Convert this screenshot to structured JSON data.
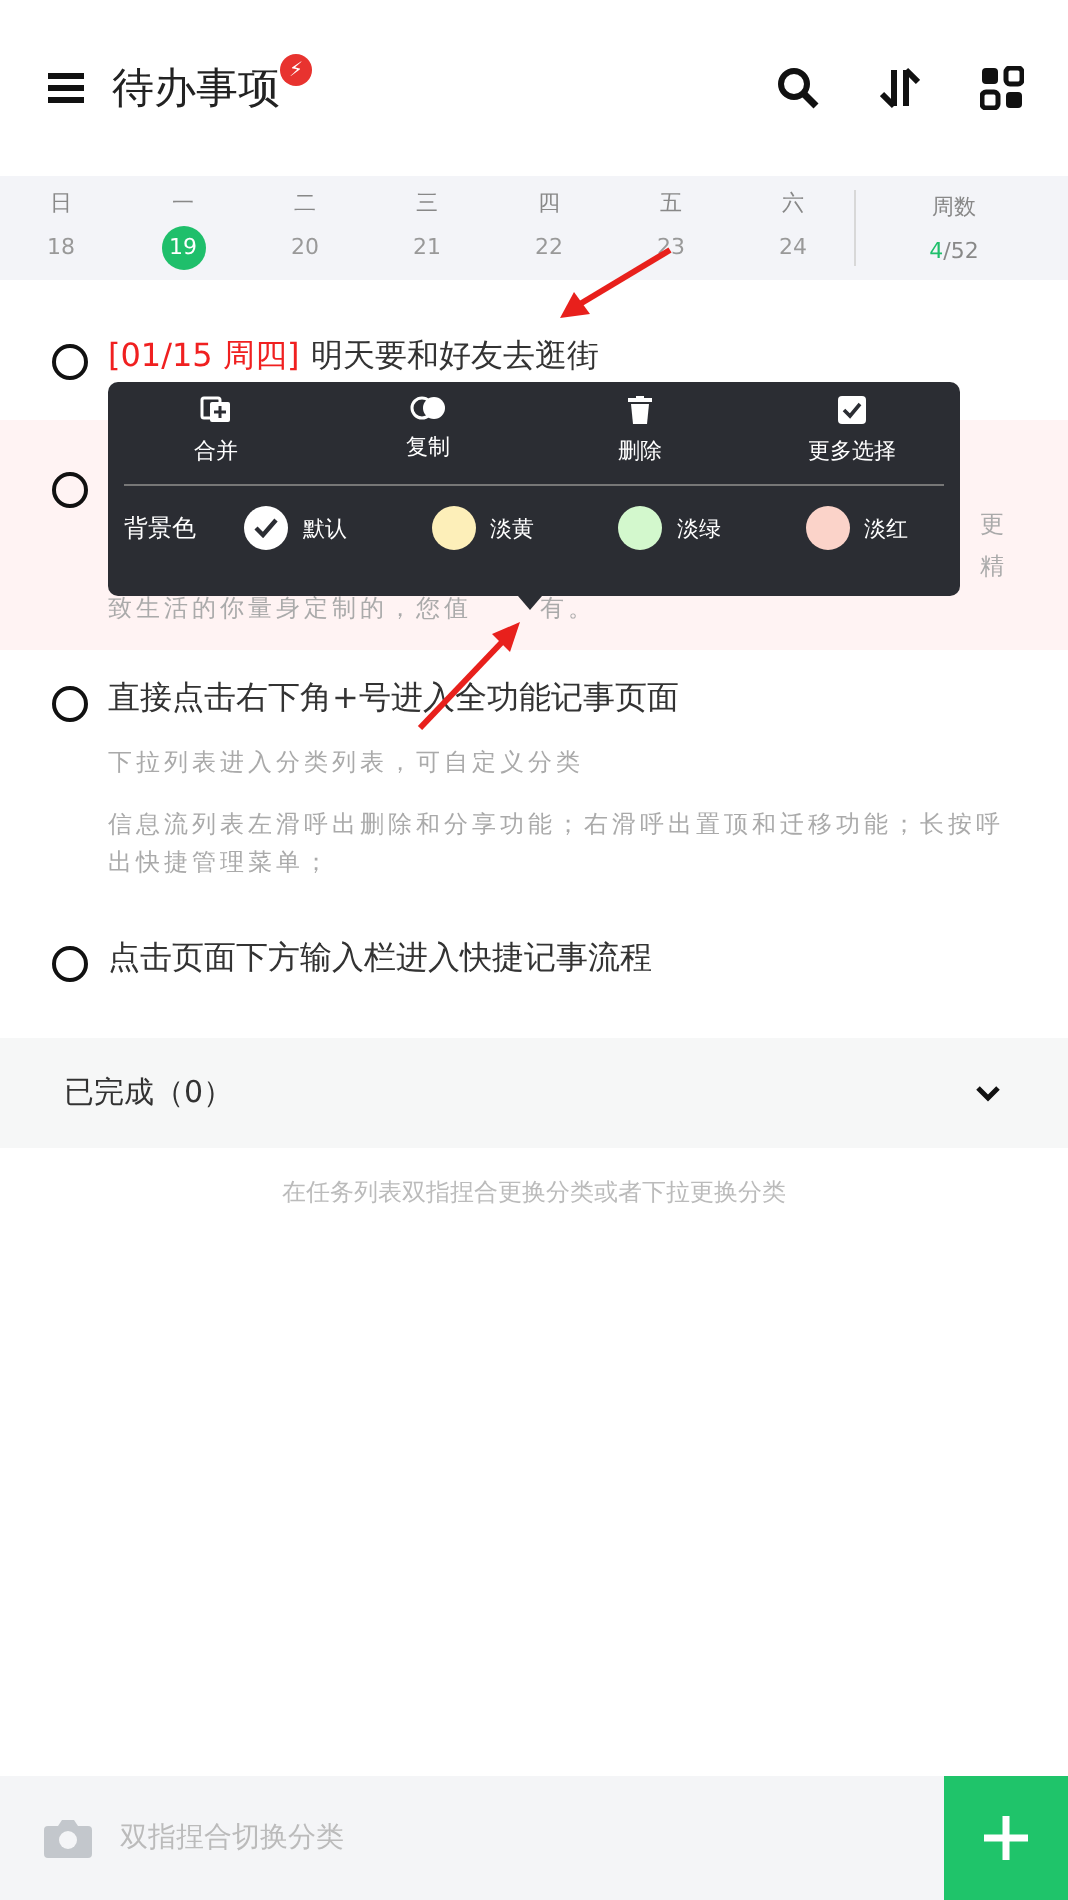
{
  "header": {
    "title": "待办事项",
    "badge": "⚡"
  },
  "week": {
    "days": [
      {
        "weekday": "日",
        "date": "18",
        "selected": false
      },
      {
        "weekday": "一",
        "date": "19",
        "selected": true
      },
      {
        "weekday": "二",
        "date": "20",
        "selected": false
      },
      {
        "weekday": "三",
        "date": "21",
        "selected": false
      },
      {
        "weekday": "四",
        "date": "22",
        "selected": false
      },
      {
        "weekday": "五",
        "date": "23",
        "selected": false
      },
      {
        "weekday": "六",
        "date": "24",
        "selected": false
      }
    ],
    "week_label": "周数",
    "week_current": "4",
    "week_total": "/52"
  },
  "tasks": [
    {
      "kind": "plain",
      "date_tag": "[01/15 周四]",
      "title": "明天要和好友去逛街",
      "highlighted": false
    },
    {
      "kind": "covered",
      "highlighted": true,
      "lines": [
        {
          "kind": "tail",
          "text": "更"
        },
        {
          "kind": "tail",
          "text": "精"
        },
        {
          "kind": "split",
          "text": "致生活的你量身定制的，您值",
          "rest": "有。"
        }
      ]
    },
    {
      "kind": "plain",
      "title": "直接点击右下角+号进入全功能记事页面",
      "highlighted": false,
      "notes": [
        "下拉列表进入分类列表，可自定义分类",
        "信息流列表左滑呼出删除和分享功能；右滑呼出置顶和迁移功能；长按呼出快捷管理菜单；"
      ]
    },
    {
      "kind": "plain",
      "title": "点击页面下方输入栏进入快捷记事流程",
      "highlighted": false
    }
  ],
  "popup": {
    "actions": [
      {
        "kind": "merge",
        "label": "合并"
      },
      {
        "kind": "copy",
        "label": "复制"
      },
      {
        "kind": "delete",
        "label": "删除"
      },
      {
        "kind": "more",
        "label": "更多选择"
      }
    ],
    "color_label": "背景色",
    "colors": [
      {
        "label": "默认",
        "color": "#ffffff",
        "selected": true
      },
      {
        "label": "淡黄",
        "color": "#fdefb9",
        "selected": false
      },
      {
        "label": "淡绿",
        "color": "#d3f8cd",
        "selected": false
      },
      {
        "label": "淡红",
        "color": "#fbd3c9",
        "selected": false
      }
    ]
  },
  "completed": {
    "label": "已完成（0）",
    "expanded": false
  },
  "hint": "在任务列表双指捏合更换分类或者下拉更换分类",
  "input_bar": {
    "placeholder": "双指捏合切换分类"
  }
}
